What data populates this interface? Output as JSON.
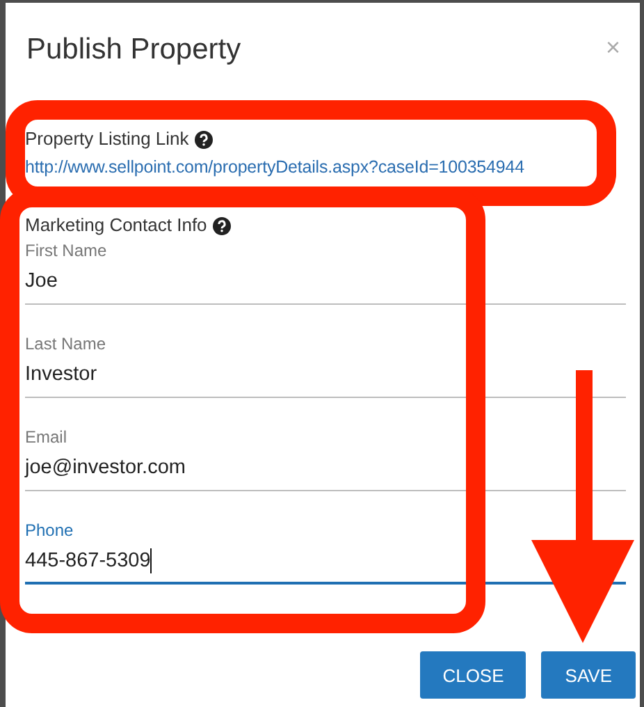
{
  "dialog": {
    "title": "Publish Property",
    "close_icon": "×"
  },
  "listing_link": {
    "label": "Property Listing Link",
    "url": "http://www.sellpoint.com/propertyDetails.aspx?caseId=100354944"
  },
  "marketing_contact": {
    "label": "Marketing Contact Info",
    "fields": [
      {
        "label": "First Name",
        "value": "Joe",
        "focused": false
      },
      {
        "label": "Last Name",
        "value": "Investor",
        "focused": false
      },
      {
        "label": "Email",
        "value": "joe@investor.com",
        "focused": false
      },
      {
        "label": "Phone",
        "value": "445-867-5309",
        "focused": true
      }
    ]
  },
  "buttons": [
    {
      "label": "CLOSE"
    },
    {
      "label": "SAVE"
    }
  ],
  "annotations": [
    {
      "kind": "outline"
    },
    {
      "kind": "outline"
    },
    {
      "kind": "arrow"
    }
  ]
}
